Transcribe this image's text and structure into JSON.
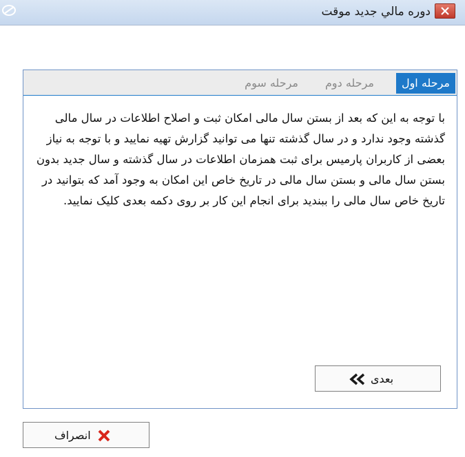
{
  "window": {
    "title": "دوره مالي جديد موقت"
  },
  "tabs": [
    {
      "label": "مرحله اول",
      "active": true
    },
    {
      "label": "مرحله دوم",
      "active": false
    },
    {
      "label": "مرحله سوم",
      "active": false
    }
  ],
  "description": "با توجه به این که بعد از بستن سال مالی امکان ثبت و اصلاح اطلاعات در سال مالی گذشته وجود ندارد و در سال گذشته تنها می توانید گزارش تهیه نمایید و با توجه به نیاز بعضی از کاربران پارمیس برای ثبت همزمان اطلاعات در سال گذشته و سال جدید بدون بستن سال مالی و بستن سال مالی در تاریخ خاص این امکان به وجود آمد که بتوانید در تاریخ خاص سال مالی را ببندید برای انجام این کار بر روی دکمه بعدی کلیک نمایید.",
  "buttons": {
    "next": "بعدی",
    "cancel": "انصراف"
  },
  "colors": {
    "accent": "#1e79c9",
    "close": "#c0392b",
    "cancel_icon": "#d9261c"
  }
}
